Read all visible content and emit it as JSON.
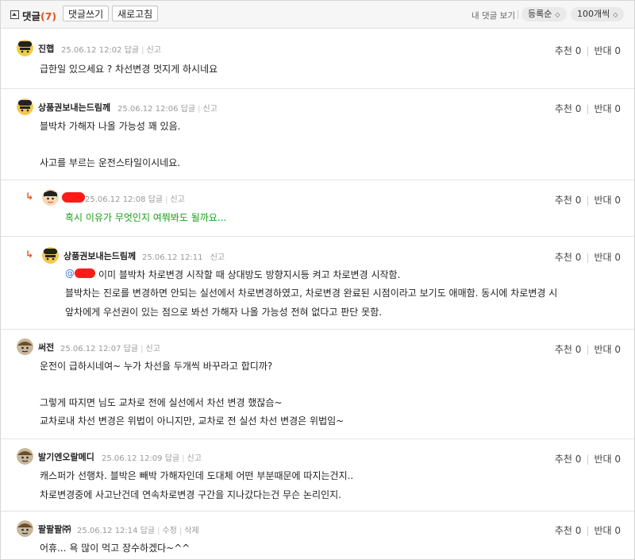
{
  "header": {
    "title": "댓글",
    "count": "(7)",
    "write_button": "댓글쓰기",
    "refresh_button": "새로고침",
    "my_comments_link": "내 댓글 보기",
    "sort_select": "등록순",
    "per_page_select": "100개씩"
  },
  "comments": [
    {
      "nickname": "진햅",
      "date": "25.06.12 12:02",
      "reply_link": "답글",
      "report_link": "신고",
      "recommend": "추천 0",
      "oppose": "반대 0",
      "lines": [
        "급한일 있으세요 ? 차선변경 멋지게 하시네요"
      ]
    },
    {
      "nickname": "상품권보내는드림께",
      "date": "25.06.12 12:06",
      "reply_link": "답글",
      "report_link": "신고",
      "recommend": "추천 0",
      "oppose": "반대 0",
      "lines": [
        "블박차 가해자 나올 가능성 꽤 있음.",
        "사고를 부르는 운전스타일이시네요."
      ]
    },
    {
      "nickname": "",
      "date": "25.06.12 12:08",
      "reply_link": "답글",
      "report_link": "신고",
      "recommend": "추천 0",
      "oppose": "반대 0",
      "reply_arrow": "↳",
      "lines": [
        "혹시 이유가 무엇인지 여쭤봐도 될까요..."
      ]
    },
    {
      "nickname": "상품권보내는드림께",
      "date": "25.06.12 12:11",
      "report_link": "신고",
      "recommend": "추천 0",
      "oppose": "반대 0",
      "reply_arrow": "↳",
      "mention": "@",
      "lines": [
        "이미 블박차 차로변경 시작할 때 상대방도 방향지시등 켜고 차로변경 시작함.",
        "블박차는 진로를 변경하면 안되는 실선에서 차로변경하였고, 차로변경 완료된 시점이라고 보기도 애매함. 동시에 차로변경 시",
        "앞차에게 우선권이 있는 점으로 봐선 가해자 나올 가능성 전혀 없다고 판단 못함."
      ]
    },
    {
      "nickname": "써전",
      "date": "25.06.12 12:07",
      "reply_link": "답글",
      "report_link": "신고",
      "recommend": "추천 0",
      "oppose": "반대 0",
      "lines": [
        "운전이 급하시네여~ 누가 차선을 두개씩 바꾸라고 합디까?",
        "그렇게 따지면 님도 교차로 전에 실선에서 차선 변경 했잖슴~",
        "교차로내 차선 변경은 위법이 아니지만, 교차로 전 실선 차선 변경은 위법임~"
      ]
    },
    {
      "nickname": "발기엔오랄메디",
      "date": "25.06.12 12:09",
      "reply_link": "답글",
      "report_link": "신고",
      "recommend": "추천 0",
      "oppose": "반대 0",
      "lines": [
        "캐스퍼가 선행차. 블박은 빼박 가해자인데 도대체 어떤 부분때문에 따지는건지..",
        "차로변경중에 사고난건데 연속차로변경 구간을 지나갔다는건 무슨 논리인지."
      ]
    },
    {
      "nickname": "팔팔팔㈜",
      "date": "25.06.12 12:14",
      "reply_link": "답글",
      "edit_link": "수정",
      "delete_link": "삭제",
      "recommend": "추천 0",
      "oppose": "반대 0",
      "lines": [
        "어휴... 욕 많이 먹고 장수하겠다~^^"
      ]
    }
  ]
}
